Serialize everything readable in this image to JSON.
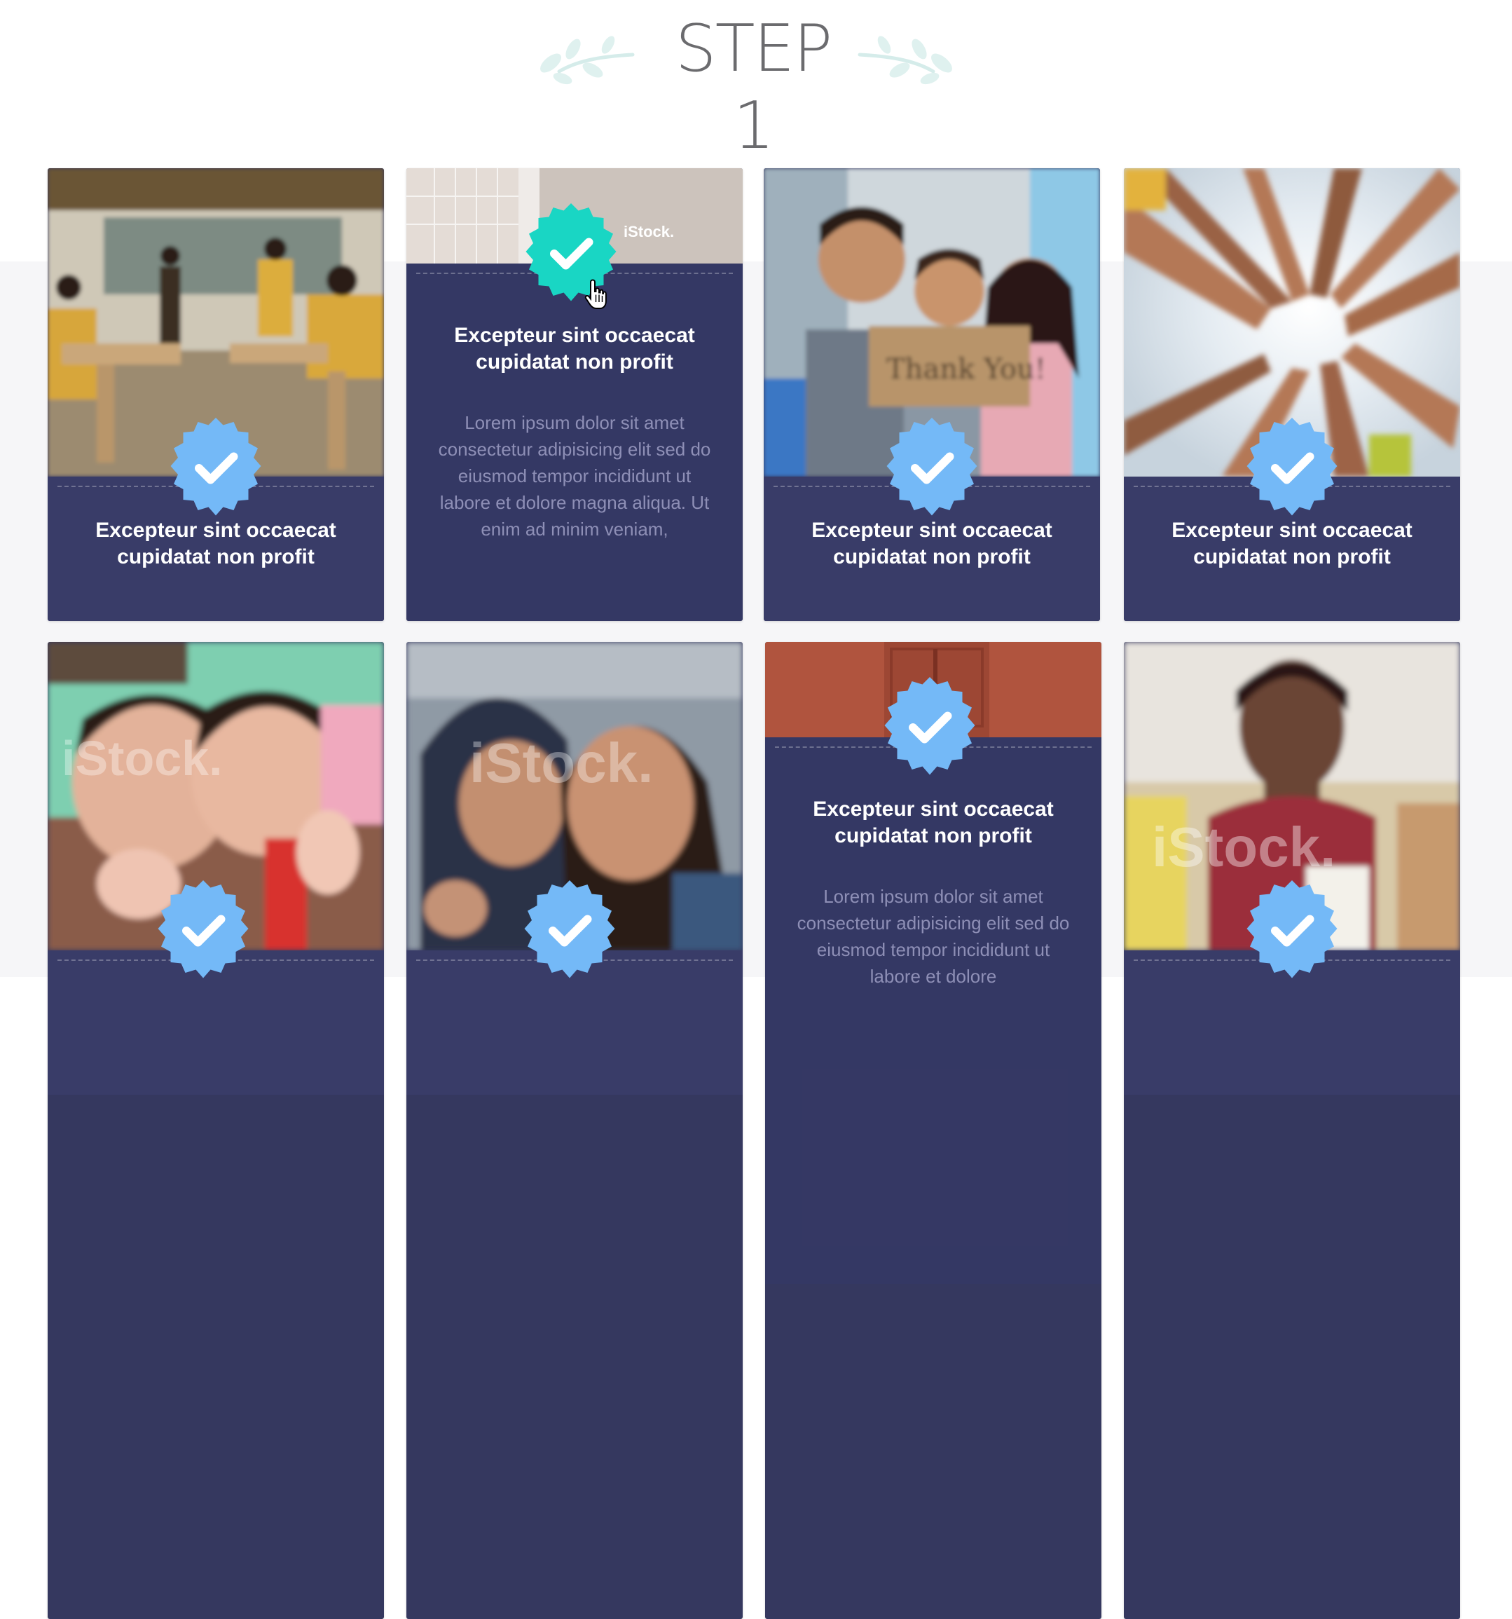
{
  "heading": {
    "title": "STEP 1"
  },
  "cards": [
    {
      "title_line1": "Excepteur sint occaecat",
      "title_line2": "cupidatat non profit",
      "body": ""
    },
    {
      "title_line1": "Excepteur sint occaecat",
      "title_line2": "cupidatat non profit",
      "body": "Lorem ipsum dolor sit amet consectetur adipisicing elit sed do eiusmod tempor incididunt ut labore et dolore magna aliqua. Ut enim ad minim veniam,"
    },
    {
      "title_line1": "Excepteur sint occaecat",
      "title_line2": "cupidatat non profit",
      "body": ""
    },
    {
      "title_line1": "Excepteur sint occaecat",
      "title_line2": "cupidatat non profit",
      "body": ""
    },
    {
      "title_line1": "",
      "title_line2": "",
      "body": ""
    },
    {
      "title_line1": "",
      "title_line2": "",
      "body": ""
    },
    {
      "title_line1": "Excepteur sint occaecat",
      "title_line2": "cupidatat non profit",
      "body": "Lorem ipsum dolor sit amet consectetur adipisicing elit sed do eiusmod tempor incididunt ut labore et dolore"
    },
    {
      "title_line1": "",
      "title_line2": "",
      "body": ""
    }
  ],
  "watermark": "iStock.",
  "colors": {
    "panel": "#393c68",
    "badge_default": "#74b9f7",
    "badge_selected": "#19d6c4",
    "page_bg": "#f6f6f8"
  },
  "icons": {
    "badge": "check-badge-icon",
    "decoration": "laurel-icon"
  }
}
